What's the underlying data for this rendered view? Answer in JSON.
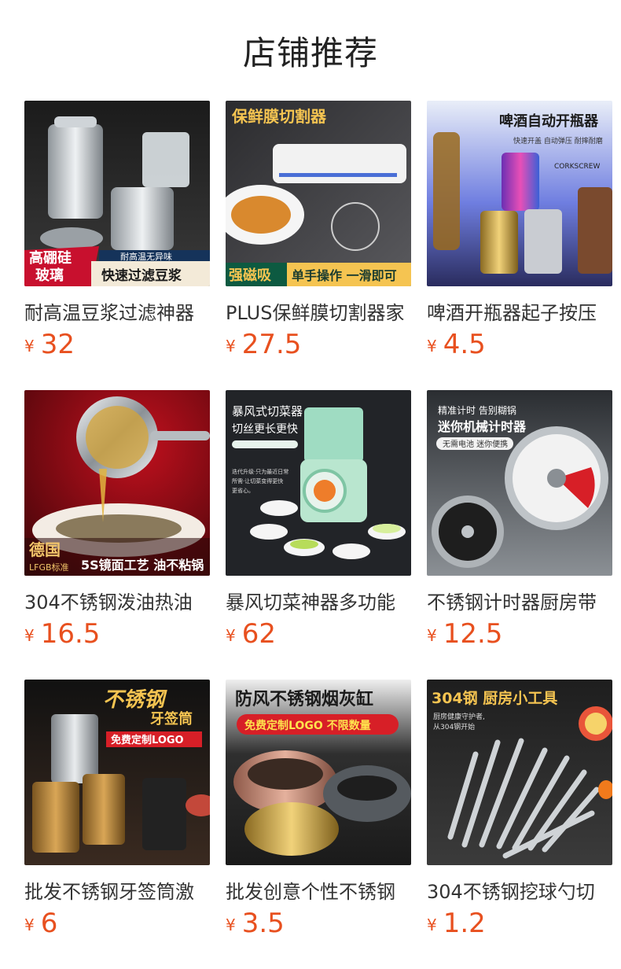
{
  "page": {
    "title": "店铺推荐"
  },
  "currency": "¥",
  "products": [
    {
      "name": "耐高温豆浆过滤神器",
      "price": "32",
      "image_text": [
        "高硼硅",
        "玻璃",
        "耐高温无异味",
        "快速过滤豆浆"
      ]
    },
    {
      "name": "PLUS保鲜膜切割器家",
      "price": "27.5",
      "image_text": [
        "保鲜膜切割器",
        "强磁吸",
        "单手操作 一滑即可"
      ]
    },
    {
      "name": "啤酒开瓶器起子按压",
      "price": "4.5",
      "image_text": [
        "啤酒自动开瓶器",
        "快速开盖 自动弹压 耐摔耐磨",
        "CORKSCREW"
      ]
    },
    {
      "name": "304不锈钢泼油热油",
      "price": "16.5",
      "image_text": [
        "德国",
        "LFGB标准",
        "5S镜面工艺 油不粘锅"
      ]
    },
    {
      "name": "暴风切菜神器多功能",
      "price": "62",
      "image_text": [
        "暴风式切菜器",
        "切丝更长更快",
        "迭代升级·只为最近日常",
        "所需·让切菜变得更快",
        "更省心。"
      ]
    },
    {
      "name": "不锈钢计时器厨房带",
      "price": "12.5",
      "image_text": [
        "精准计时 告别糊锅",
        "迷你机械计时器",
        "无需电池 迷你便携"
      ]
    },
    {
      "name": "批发不锈钢牙签筒激",
      "price": "6",
      "image_text": [
        "不锈钢",
        "牙签筒",
        "免费定制LOGO"
      ]
    },
    {
      "name": "批发创意个性不锈钢",
      "price": "3.5",
      "image_text": [
        "防风不锈钢烟灰缸",
        "免费定制LOGO 不限数量"
      ]
    },
    {
      "name": "304不锈钢挖球勺切",
      "price": "1.2",
      "image_text": [
        "304钢 厨房小工具",
        "厨房健康守护者,",
        "从304钢开始"
      ]
    }
  ]
}
